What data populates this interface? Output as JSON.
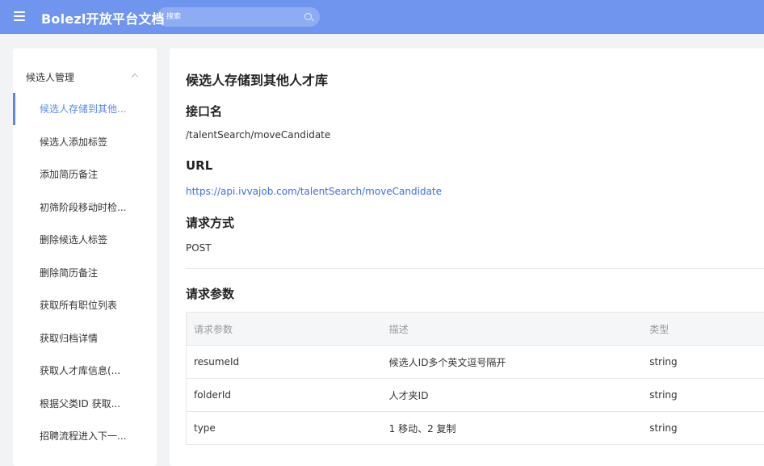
{
  "header": {
    "brand": "Bolezl开放平台文档",
    "search_placeholder": "搜索"
  },
  "sidebar": {
    "group_title": "候选人管理",
    "items": [
      {
        "label": "候选人存储到其他..."
      },
      {
        "label": "候选人添加标签"
      },
      {
        "label": "添加简历备注"
      },
      {
        "label": "初筛阶段移动时检..."
      },
      {
        "label": "删除候选人标签"
      },
      {
        "label": "删除简历备注"
      },
      {
        "label": "获取所有职位列表"
      },
      {
        "label": "获取归档详情"
      },
      {
        "label": "获取人才库信息(..."
      },
      {
        "label": "根据父类ID 获取..."
      },
      {
        "label": "招聘流程进入下一..."
      }
    ]
  },
  "doc": {
    "title": "候选人存储到其他人才库",
    "api_name_heading": "接口名",
    "api_name": "/talentSearch/moveCandidate",
    "url_heading": "URL",
    "url": "https://api.ivvajob.com/talentSearch/moveCandidate",
    "method_heading": "请求方式",
    "method": "POST",
    "params_heading": "请求参数",
    "table": {
      "headers": [
        "请求参数",
        "描述",
        "类型"
      ],
      "rows": [
        [
          "resumeId",
          "候选人ID多个英文逗号隔开",
          "string"
        ],
        [
          "folderId",
          "人才夹ID",
          "string"
        ],
        [
          "type",
          "1 移动、2 复制",
          "string"
        ]
      ]
    }
  },
  "colors": {
    "topbar": "#6f95ee",
    "accent": "#5a87e8",
    "link": "#3b6ee8"
  }
}
